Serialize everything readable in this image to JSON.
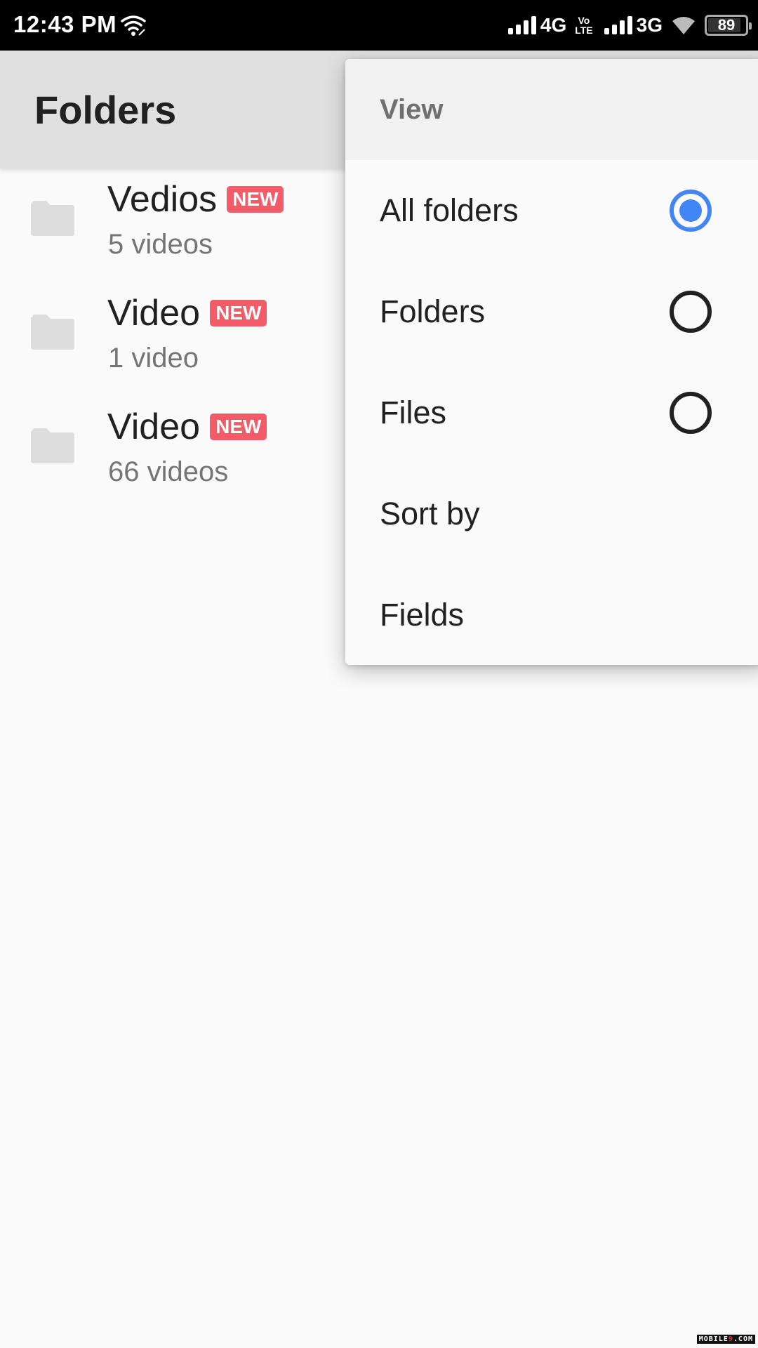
{
  "status_bar": {
    "time": "12:43 PM",
    "network_1": "4G",
    "volte_top": "Vo",
    "volte_bottom": "LTE",
    "network_2": "3G",
    "battery_level": 89,
    "battery_text": "89"
  },
  "app_bar": {
    "title": "Folders"
  },
  "folders": [
    {
      "name": "Vedios",
      "badge": "NEW",
      "count": "5 videos"
    },
    {
      "name": "Video",
      "badge": "NEW",
      "count": "1 video"
    },
    {
      "name": "Video",
      "badge": "NEW",
      "count": "66 videos"
    }
  ],
  "menu": {
    "header": "View",
    "options": [
      {
        "label": "All folders",
        "selected": true
      },
      {
        "label": "Folders",
        "selected": false
      },
      {
        "label": "Files",
        "selected": false
      }
    ],
    "actions": [
      {
        "label": "Sort by"
      },
      {
        "label": "Fields"
      }
    ]
  },
  "colors": {
    "accent": "#4285f4",
    "badge": "#f45b69",
    "appbar": "#e0e0e0",
    "background": "#fafafa"
  },
  "watermark": {
    "prefix": "MOBILE",
    "nine": "9",
    "suffix": ".COM"
  }
}
